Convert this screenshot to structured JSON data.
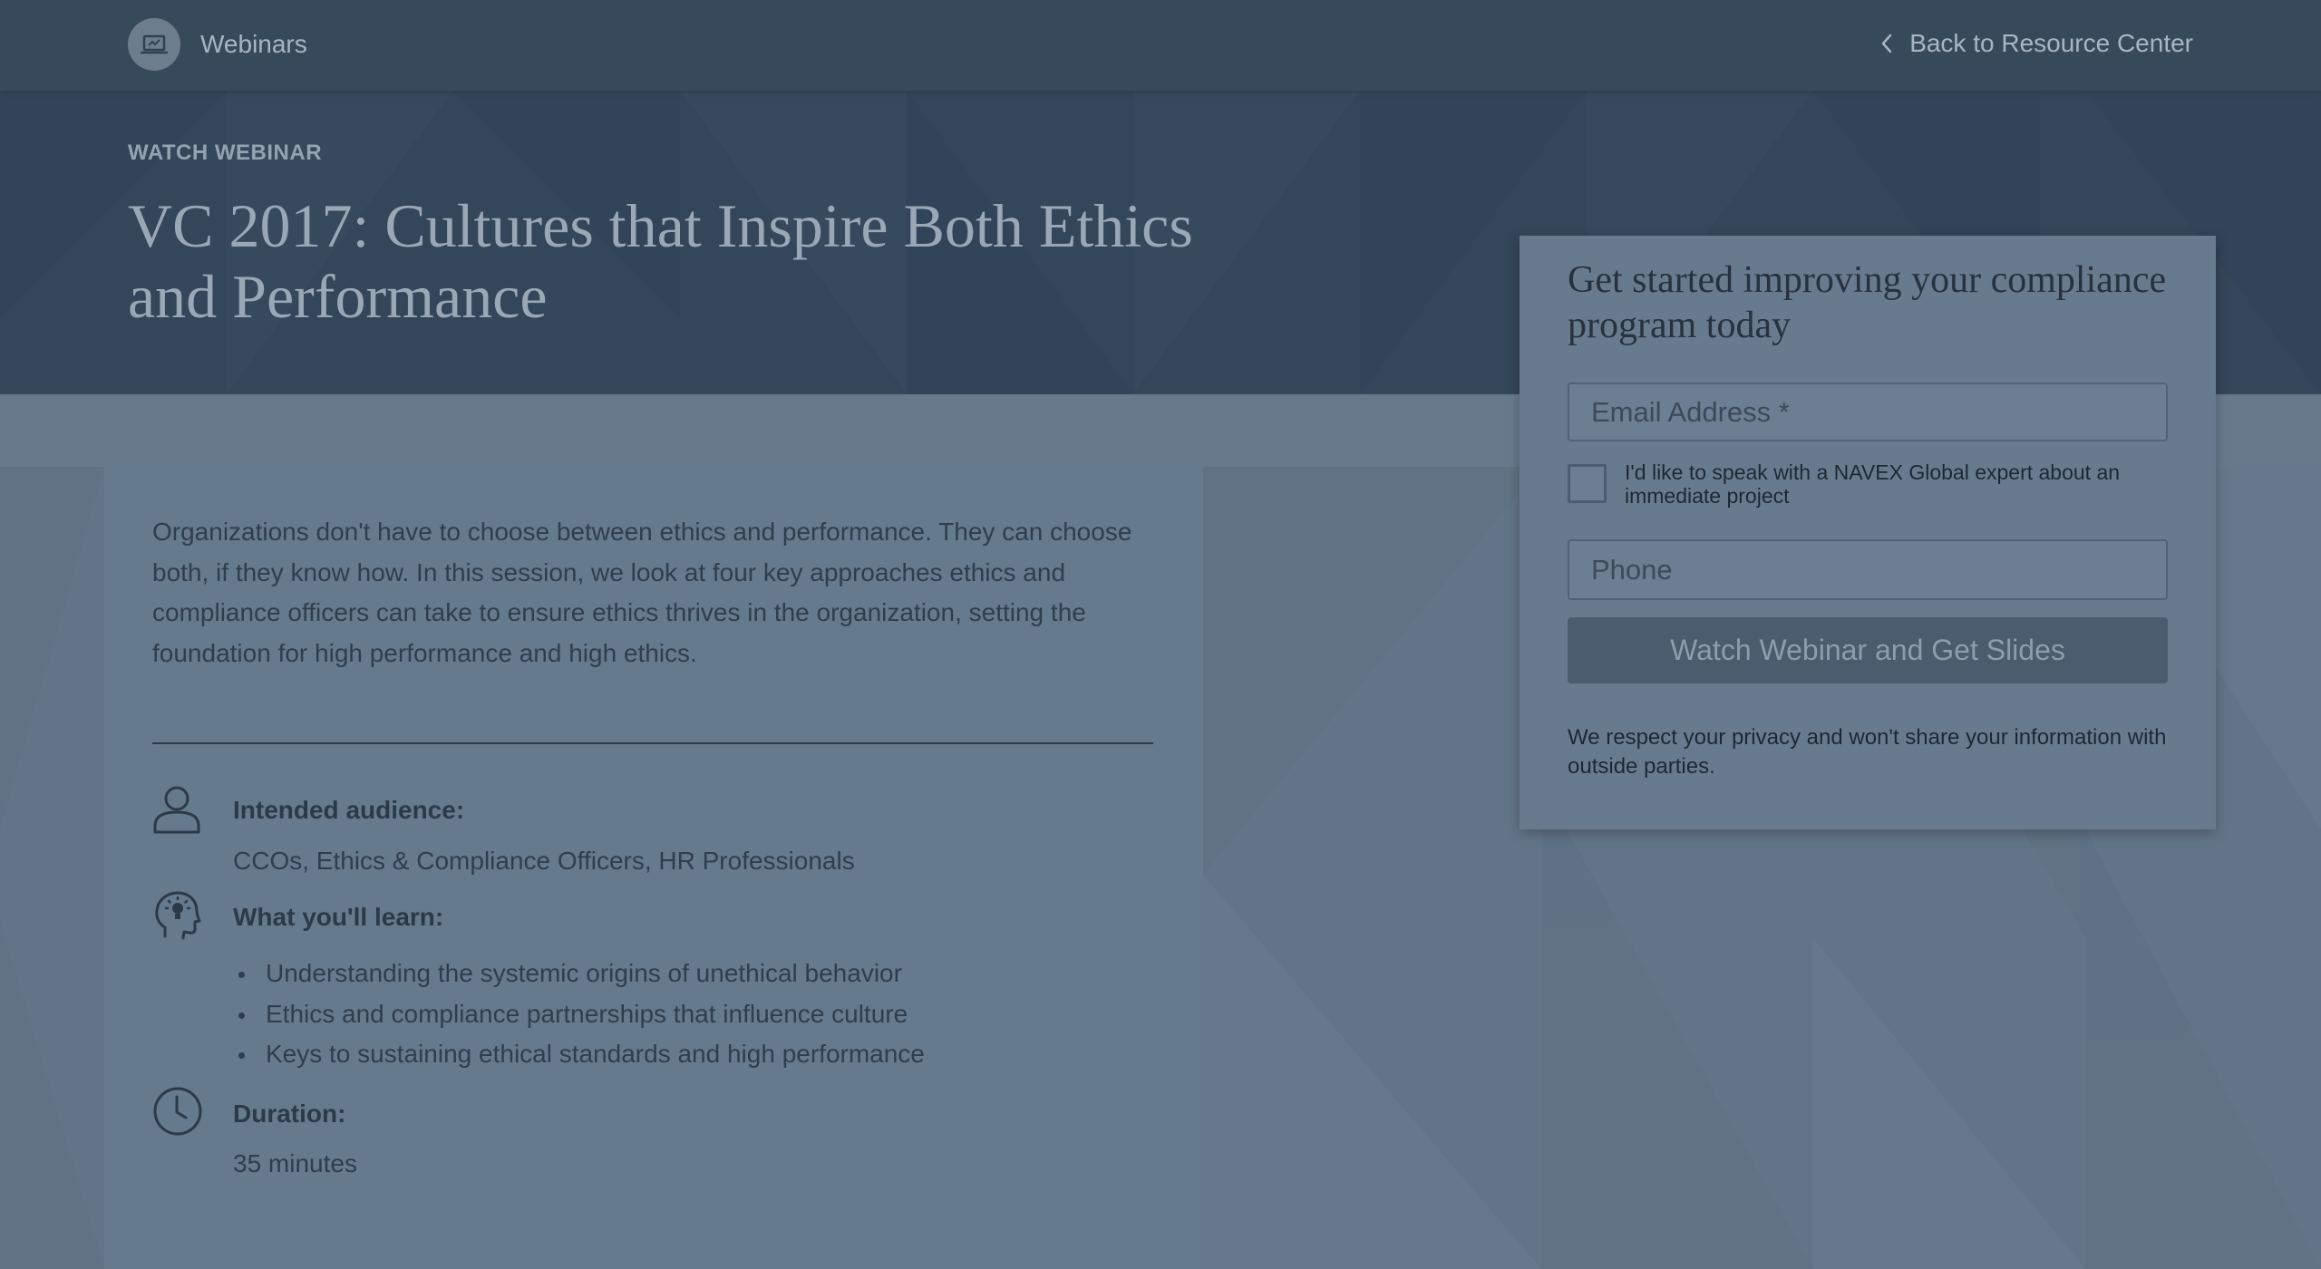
{
  "header": {
    "section_label": "Webinars",
    "back_link_label": "Back to Resource Center",
    "icons": {
      "section": "laptop-icon",
      "back": "chevron-left-icon"
    }
  },
  "hero": {
    "eyebrow": "WATCH WEBINAR",
    "title": "VC 2017: Cultures that Inspire Both Ethics and Performance"
  },
  "content": {
    "description": "Organizations don't have to choose between ethics and performance. They can choose both, if they know how. In this session, we look at four key approaches ethics and compliance officers can take to ensure ethics thrives in the organization, setting the foundation for high performance and high ethics.",
    "audience": {
      "label": "Intended audience:",
      "value": "CCOs, Ethics & Compliance Officers, HR Professionals",
      "icon": "user-icon"
    },
    "learn": {
      "label": "What you'll learn:",
      "icon": "head-lightbulb-icon",
      "items": [
        "Understanding the systemic origins of unethical behavior",
        "Ethics and compliance partnerships that influence culture",
        "Keys to sustaining ethical standards and high performance"
      ]
    },
    "duration": {
      "label": "Duration:",
      "value": "35 minutes",
      "icon": "clock-icon"
    }
  },
  "form": {
    "title": "Get started improving your compliance program today",
    "email_placeholder": "Email Address *",
    "email_value": "",
    "checkbox_label": "I'd like to speak with a NAVEX Global expert about an immediate project",
    "checkbox_checked": false,
    "phone_placeholder": "Phone",
    "phone_value": "",
    "submit_label": "Watch Webinar and Get Slides",
    "privacy_note": "We respect your privacy and won't share your information with outside parties."
  },
  "colors": {
    "overlay_tint": "#627588",
    "header_bg": "#374a5c",
    "hero_bg": "#344659",
    "button_bg": "#4a5c6e"
  }
}
